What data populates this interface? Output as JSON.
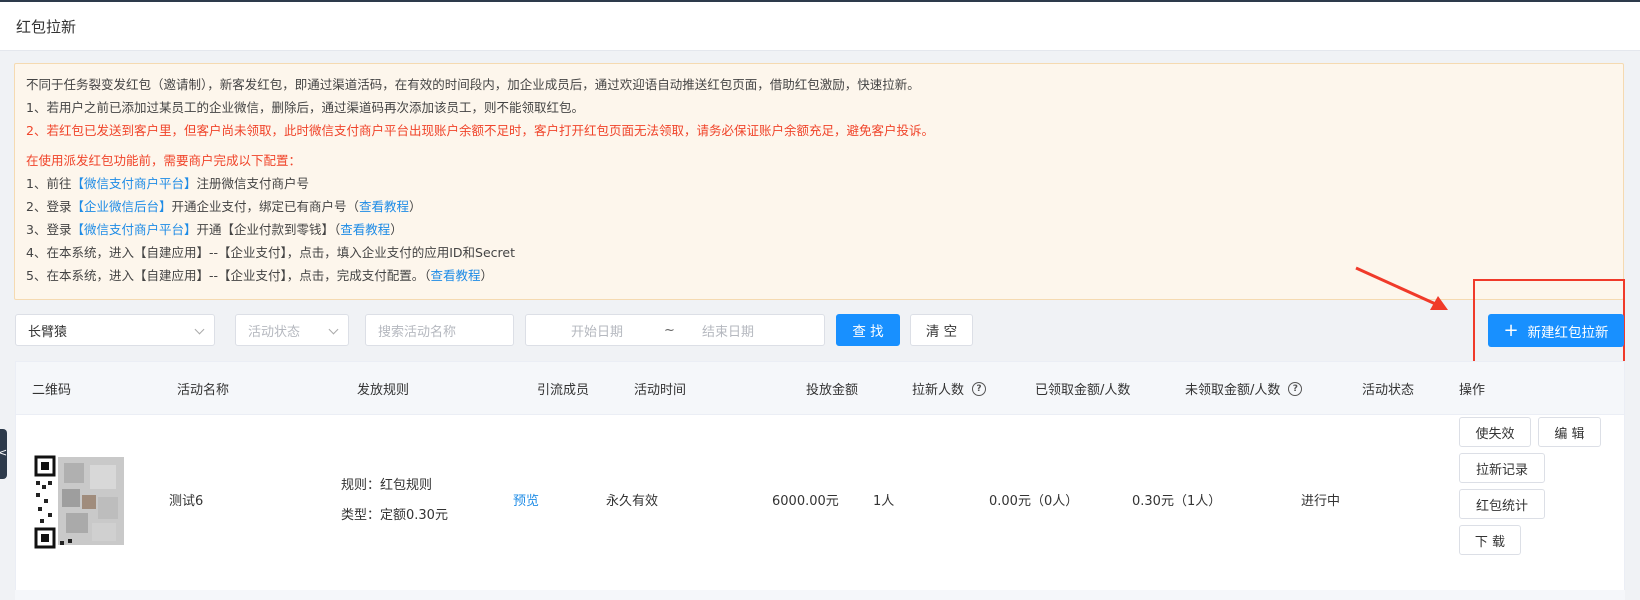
{
  "header": {
    "title": "红包拉新"
  },
  "notice": {
    "intro": "不同于任务裂变发红包（邀请制），新客发红包，即通过渠道活码，在有效的时间段内，加企业成员后，通过欢迎语自动推送红包页面，借助红包激励，快速拉新。",
    "rule1": "1、若用户之前已添加过某员工的企业微信，删除后，通过渠道码再次添加该员工，则不能领取红包。",
    "rule2": "2、若红包已发送到客户里，但客户尚未领取，此时微信支付商户平台出现账户余额不足时，客户打开红包页面无法领取，请务必保证账户余额充足，避免客户投诉。",
    "setup_title": "在使用派发红包功能前，需要商户完成以下配置：",
    "step1_pre": "1、前往",
    "step1_link": "【微信支付商户平台】",
    "step1_post": "注册微信支付商户号",
    "step2_pre": "2、登录",
    "step2_link": "【企业微信后台】",
    "step2_mid": "开通企业支付，绑定已有商户号（",
    "step2_tutorial": "查看教程",
    "step2_post": "）",
    "step3_pre": "3、登录",
    "step3_link": "【微信支付商户平台】",
    "step3_mid": "开通【企业付款到零钱】（",
    "step3_tutorial": "查看教程",
    "step3_post": "）",
    "step4": "4、在本系统，进入【自建应用】--【企业支付】，点击，填入企业支付的应用ID和Secret",
    "step5_pre": "5、在本系统，进入【自建应用】--【企业支付】，点击，完成支付配置。（",
    "step5_tutorial": "查看教程",
    "step5_post": "）"
  },
  "filters": {
    "company_value": "长臂猿",
    "status_placeholder": "活动状态",
    "search_placeholder": "搜索活动名称",
    "start_date_placeholder": "开始日期",
    "date_separator": "~",
    "end_date_placeholder": "结束日期",
    "search_button": "查 找",
    "clear_button": "清 空"
  },
  "new_button": {
    "plus": "+",
    "label": "新建红包拉新"
  },
  "table": {
    "headers": {
      "qr": "二维码",
      "name": "活动名称",
      "rule": "发放规则",
      "member": "引流成员",
      "time": "活动时间",
      "amount": "投放金额",
      "new_count": "拉新人数",
      "received": "已领取金额/人数",
      "unreceived": "未领取金额/人数",
      "status": "活动状态",
      "ops": "操作"
    },
    "help_glyph": "?",
    "row": {
      "name": "测试6",
      "rule_line1": "规则：红包规则",
      "rule_line2": "类型：定额0.30元",
      "member_link": "预览",
      "time": "永久有效",
      "amount": "6000.00元",
      "new_count": "1人",
      "received": "0.00元（0人）",
      "unreceived": "0.30元（1人）",
      "status": "进行中",
      "ops": {
        "invalidate": "使失效",
        "edit": "编 辑",
        "records": "拉新记录",
        "stats": "红包统计",
        "download": "下 载"
      }
    }
  },
  "colors": {
    "primary": "#1890ff",
    "warning_red": "#f0442a",
    "link": "#1f8ce6",
    "notice_bg": "#fdf6ec",
    "annotation_red": "#f03a2a"
  },
  "side_tab_glyph": "<"
}
